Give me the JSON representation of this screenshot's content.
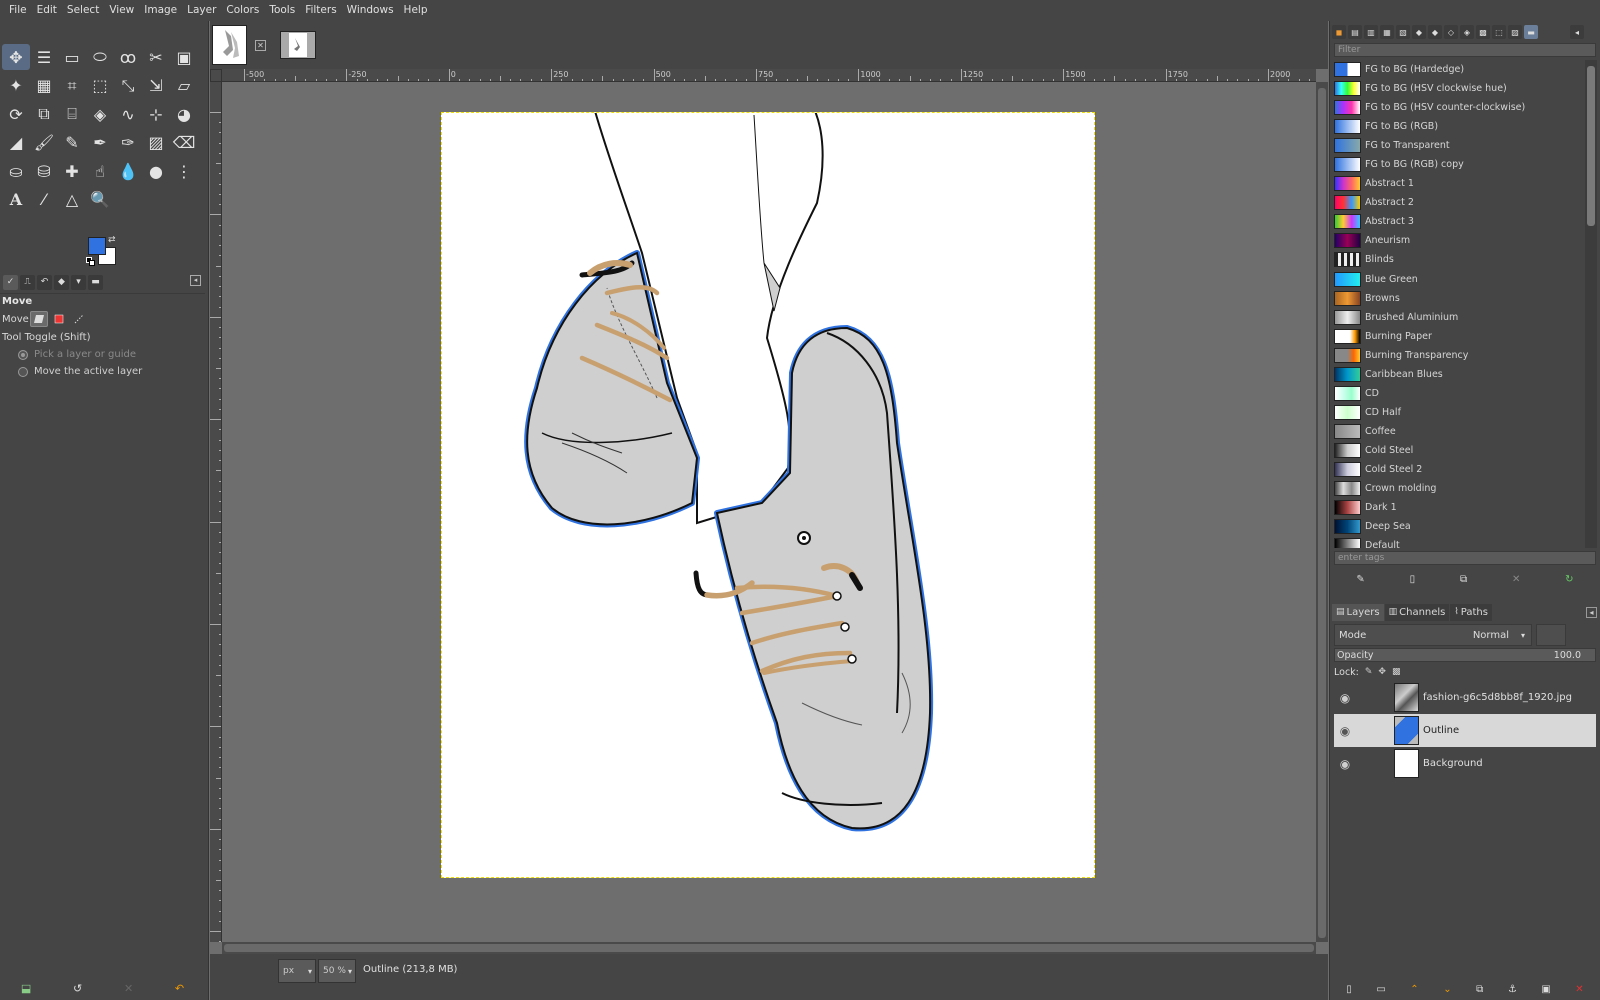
{
  "menubar": {
    "items": [
      "File",
      "Edit",
      "Select",
      "View",
      "Image",
      "Layer",
      "Colors",
      "Tools",
      "Filters",
      "Windows",
      "Help"
    ]
  },
  "toolbox": {
    "active_tool": "move-tool",
    "fg_color": "#2f72e0",
    "bg_color": "#ffffff"
  },
  "tool_options": {
    "title": "Move",
    "move_label": "Move:",
    "toggle_label": "Tool Toggle  (Shift)",
    "radio_pick": "Pick a layer or guide",
    "radio_move_active": "Move the active layer"
  },
  "ruler": {
    "h_labels": [
      "-500",
      "-250",
      "0",
      "250",
      "500",
      "750",
      "1000",
      "1250",
      "1500",
      "1750",
      "2000"
    ]
  },
  "status": {
    "unit": "px",
    "zoom": "50 %",
    "text": "Outline (213,8 MB)"
  },
  "gradients": {
    "filter_placeholder": "Filter",
    "tag_placeholder": "enter tags",
    "items": [
      {
        "name": "FG to BG (Hardedge)",
        "sw": "linear-gradient(90deg,#2f72e0 50%,#fff 50%)"
      },
      {
        "name": "FG to BG (HSV clockwise hue)",
        "sw": "linear-gradient(90deg,#2f72e0,#3ff,#3f3,#ff3,#fff)"
      },
      {
        "name": "FG to BG (HSV counter-clockwise)",
        "sw": "linear-gradient(90deg,#2f72e0,#a3f,#f3a,#fff)"
      },
      {
        "name": "FG to BG (RGB)",
        "sw": "linear-gradient(90deg,#2f72e0,#fff)"
      },
      {
        "name": "FG to Transparent",
        "sw": "linear-gradient(90deg,#2f72e0,#8aa)"
      },
      {
        "name": "FG to BG (RGB) copy",
        "sw": "linear-gradient(90deg,#2f72e0,#fff)"
      },
      {
        "name": "Abstract 1",
        "sw": "linear-gradient(90deg,#33f,#c3c,#f66,#fc3)"
      },
      {
        "name": "Abstract 2",
        "sw": "linear-gradient(90deg,#f06,#f33,#39f,#fc0)"
      },
      {
        "name": "Abstract 3",
        "sw": "linear-gradient(90deg,#3c3,#fc3,#c3f,#3cf)"
      },
      {
        "name": "Aneurism",
        "sw": "linear-gradient(90deg,#206,#905,#204)"
      },
      {
        "name": "Blinds",
        "sw": "repeating-linear-gradient(90deg,#222 0 3px,#eee 3px 6px)"
      },
      {
        "name": "Blue Green",
        "sw": "linear-gradient(90deg,#29f,#2ee)"
      },
      {
        "name": "Browns",
        "sw": "linear-gradient(90deg,#a62,#e93,#842)"
      },
      {
        "name": "Brushed Aluminium",
        "sw": "linear-gradient(90deg,#999,#eee,#888)"
      },
      {
        "name": "Burning Paper",
        "sw": "linear-gradient(90deg,#fff 60%,#f90,#000)"
      },
      {
        "name": "Burning Transparency",
        "sw": "linear-gradient(90deg,#888 50%,#f60,#fc3)"
      },
      {
        "name": "Caribbean Blues",
        "sw": "linear-gradient(90deg,#036,#09c,#3c9)"
      },
      {
        "name": "CD",
        "sw": "linear-gradient(90deg,#fff,#cfe,#9fc,#fff)"
      },
      {
        "name": "CD Half",
        "sw": "linear-gradient(90deg,#fff,#cfc,#fff)"
      },
      {
        "name": "Coffee",
        "sw": "linear-gradient(90deg,#888,#bbb)"
      },
      {
        "name": "Cold Steel",
        "sw": "linear-gradient(90deg,#222,#ccc,#fff)"
      },
      {
        "name": "Cold Steel 2",
        "sw": "linear-gradient(90deg,#335,#ccd,#fff)"
      },
      {
        "name": "Crown molding",
        "sw": "linear-gradient(90deg,#444,#ddd,#888,#eee)"
      },
      {
        "name": "Dark 1",
        "sw": "linear-gradient(90deg,#000,#a44,#fcc)"
      },
      {
        "name": "Deep Sea",
        "sw": "linear-gradient(90deg,#013,#047,#39c)"
      },
      {
        "name": "Default",
        "sw": "linear-gradient(90deg,#000,#fff)"
      }
    ]
  },
  "layers_panel": {
    "tabs": [
      "Layers",
      "Channels",
      "Paths"
    ],
    "mode_label": "Mode",
    "mode_value": "Normal",
    "opacity_label": "Opacity",
    "opacity_value": "100.0",
    "lock_label": "Lock:",
    "layers": [
      {
        "name": "fashion-g6c5d8bb8f_1920.jpg",
        "selected": false
      },
      {
        "name": "Outline",
        "selected": true
      },
      {
        "name": "Background",
        "selected": false
      }
    ]
  },
  "image_tabs": {
    "count": 2
  }
}
